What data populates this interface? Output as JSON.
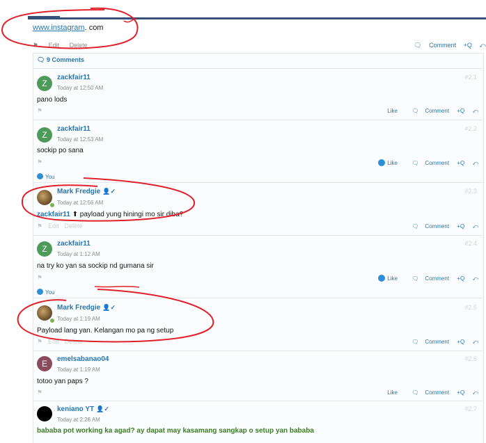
{
  "post": {
    "url_link": "www.instagram",
    "url_suffix": ". com",
    "edit": "Edit",
    "delete": "Delete",
    "comment": "Comment",
    "quote": "+Q"
  },
  "comments_header": "9 Comments",
  "comments": [
    {
      "user": "zackfair11",
      "avatar_letter": "Z",
      "avatar_color": "#4d9a5b",
      "time": "Today at 12:50 AM",
      "num": "#2.1",
      "text": "pano lods"
    },
    {
      "user": "zackfair11",
      "avatar_letter": "Z",
      "avatar_color": "#4d9a5b",
      "time": "Today at 12:53 AM",
      "num": "#2.2",
      "text": "sockip po sana",
      "likes": "You"
    },
    {
      "user": "Mark Fredgie",
      "time": "Today at 12:56 AM",
      "num": "#2.3",
      "mention": "zackfair11",
      "text": "payload yung hiningi mo sir diba?"
    },
    {
      "user": "zackfair11",
      "avatar_letter": "Z",
      "avatar_color": "#4d9a5b",
      "time": "Today at 1:12 AM",
      "num": "#2.4",
      "text": "na try ko yan sa sockip nd gumana sir",
      "likes": "You"
    },
    {
      "user": "Mark Fredgie",
      "time": "Today at 1:19 AM",
      "num": "#2.5",
      "text": "Payload lang yan. Kelangan mo pa ng setup"
    },
    {
      "user": "emelsabanao04",
      "avatar_letter": "E",
      "avatar_color": "#8a4c5c",
      "time": "Today at 1:19 AM",
      "num": "#2.6",
      "text": "totoo yan paps ?"
    },
    {
      "user": "keniano YT",
      "avatar_color": "#000000",
      "time": "Today at 2:26 AM",
      "num": "#2.7",
      "text": "bababa pot working ka agad? ay dapat may kasamang sangkap o setup yan bababa"
    }
  ],
  "actions": {
    "like": "Like",
    "comment": "Comment",
    "quote": "+Q",
    "edit": "Edit",
    "delete": "Delete"
  },
  "colors": {
    "link": "#2577b1",
    "accent_bar": "#37507a",
    "annotation": "#e0202a"
  }
}
